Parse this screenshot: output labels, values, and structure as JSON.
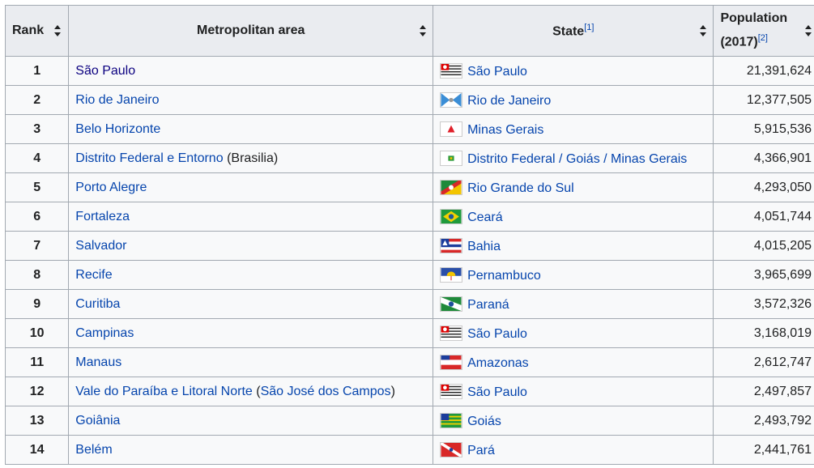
{
  "headers": {
    "rank": "Rank",
    "metro": "Metropolitan area",
    "state": "State",
    "state_ref": "[1]",
    "pop_line1": "Population",
    "pop_line2": "(2017)",
    "pop_ref": "[2]"
  },
  "rows": [
    {
      "rank": "1",
      "metro": "São Paulo",
      "metro_extra": "",
      "metro_extra_link": "",
      "state": "São Paulo",
      "flag": "sao-paulo-flag-icon",
      "population": "21,391,624"
    },
    {
      "rank": "2",
      "metro": "Rio de Janeiro",
      "metro_extra": "",
      "metro_extra_link": "",
      "state": "Rio de Janeiro",
      "flag": "rio-de-janeiro-flag-icon",
      "population": "12,377,505"
    },
    {
      "rank": "3",
      "metro": "Belo Horizonte",
      "metro_extra": "",
      "metro_extra_link": "",
      "state": "Minas Gerais",
      "flag": "minas-gerais-flag-icon",
      "population": "5,915,536"
    },
    {
      "rank": "4",
      "metro": "Distrito Federal e Entorno",
      "metro_extra": "(Brasilia)",
      "metro_extra_link": "",
      "state": "Distrito Federal / Goiás / Minas Gerais",
      "flag": "distrito-federal-flag-icon",
      "population": "4,366,901"
    },
    {
      "rank": "5",
      "metro": "Porto Alegre",
      "metro_extra": "",
      "metro_extra_link": "",
      "state": "Rio Grande do Sul",
      "flag": "rio-grande-do-sul-flag-icon",
      "population": "4,293,050"
    },
    {
      "rank": "6",
      "metro": "Fortaleza",
      "metro_extra": "",
      "metro_extra_link": "",
      "state": "Ceará",
      "flag": "ceara-flag-icon",
      "population": "4,051,744"
    },
    {
      "rank": "7",
      "metro": "Salvador",
      "metro_extra": "",
      "metro_extra_link": "",
      "state": "Bahia",
      "flag": "bahia-flag-icon",
      "population": "4,015,205"
    },
    {
      "rank": "8",
      "metro": "Recife",
      "metro_extra": "",
      "metro_extra_link": "",
      "state": "Pernambuco",
      "flag": "pernambuco-flag-icon",
      "population": "3,965,699"
    },
    {
      "rank": "9",
      "metro": "Curitiba",
      "metro_extra": "",
      "metro_extra_link": "",
      "state": "Paraná",
      "flag": "parana-flag-icon",
      "population": "3,572,326"
    },
    {
      "rank": "10",
      "metro": "Campinas",
      "metro_extra": "",
      "metro_extra_link": "",
      "state": "São Paulo",
      "flag": "sao-paulo-flag-icon",
      "population": "3,168,019"
    },
    {
      "rank": "11",
      "metro": "Manaus",
      "metro_extra": "",
      "metro_extra_link": "",
      "state": "Amazonas",
      "flag": "amazonas-flag-icon",
      "population": "2,612,747"
    },
    {
      "rank": "12",
      "metro": "Vale do Paraíba e Litoral Norte",
      "metro_extra": "",
      "metro_extra_link": "São José dos Campos",
      "state": "São Paulo",
      "flag": "sao-paulo-flag-icon",
      "population": "2,497,857"
    },
    {
      "rank": "13",
      "metro": "Goiânia",
      "metro_extra": "",
      "metro_extra_link": "",
      "state": "Goiás",
      "flag": "goias-flag-icon",
      "population": "2,493,792"
    },
    {
      "rank": "14",
      "metro": "Belém",
      "metro_extra": "",
      "metro_extra_link": "",
      "state": "Pará",
      "flag": "para-flag-icon",
      "population": "2,441,761"
    }
  ],
  "colors": {
    "link": "#0645ad",
    "visited_link": "#0b0080",
    "header_bg": "#eaecf0",
    "cell_bg": "#f8f9fa",
    "border": "#a2a9b1"
  }
}
